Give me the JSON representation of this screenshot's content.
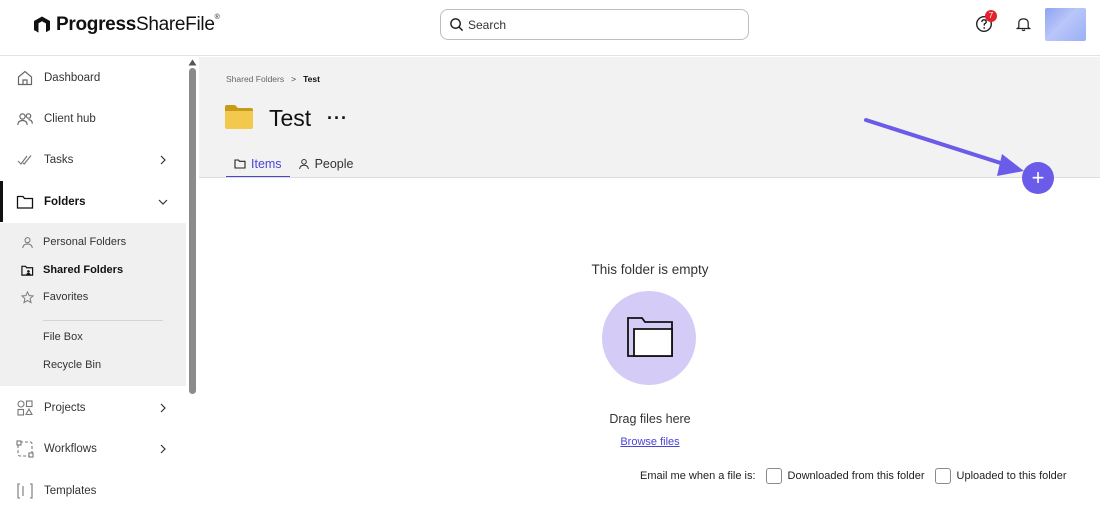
{
  "brand": {
    "name_bold": "Progress",
    "name_rest": "ShareFile"
  },
  "search": {
    "placeholder": "Search"
  },
  "help": {
    "badge_count": "7"
  },
  "sidebar": {
    "items": [
      {
        "label": "Dashboard",
        "icon": "home-icon"
      },
      {
        "label": "Client hub",
        "icon": "people-icon"
      },
      {
        "label": "Tasks",
        "icon": "check-icon"
      },
      {
        "label": "Folders",
        "icon": "folder-icon"
      },
      {
        "label": "Projects",
        "icon": "shapes-icon"
      },
      {
        "label": "Workflows",
        "icon": "workflow-icon"
      },
      {
        "label": "Templates",
        "icon": "template-icon"
      }
    ],
    "folder_subitems": [
      {
        "label": "Personal Folders",
        "icon": "person-icon"
      },
      {
        "label": "Shared Folders",
        "icon": "shared-folder-icon"
      },
      {
        "label": "Favorites",
        "icon": "star-icon"
      },
      {
        "label": "File Box"
      },
      {
        "label": "Recycle Bin"
      }
    ]
  },
  "breadcrumb": {
    "parent": "Shared Folders",
    "separator": ">",
    "current": "Test"
  },
  "folder": {
    "title": "Test",
    "more": "···"
  },
  "tabs": [
    {
      "label": "Items"
    },
    {
      "label": "People"
    }
  ],
  "empty_state": {
    "title": "This folder is empty",
    "drag_text": "Drag files here",
    "browse_link": "Browse files"
  },
  "email_notify": {
    "label": "Email me when a file is:",
    "option_downloaded": "Downloaded from this folder",
    "option_uploaded": "Uploaded to this folder"
  },
  "colors": {
    "accent": "#4b44d6",
    "fab": "#6a5ce8",
    "empty_circle": "#d4ccf6",
    "folder_yellow": "#f2c94c"
  }
}
